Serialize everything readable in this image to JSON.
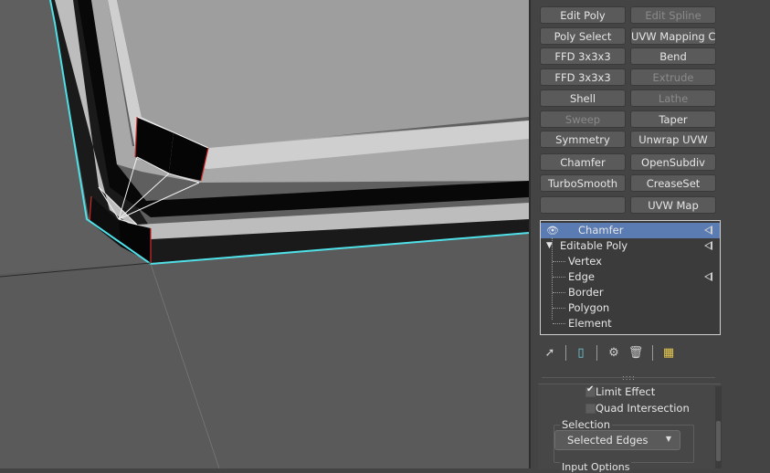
{
  "modifier_buttons": [
    {
      "label": "Edit Poly",
      "enabled": true
    },
    {
      "label": "Edit Spline",
      "enabled": false
    },
    {
      "label": "Poly Select",
      "enabled": true
    },
    {
      "label": "UVW Mapping Clear",
      "enabled": true
    },
    {
      "label": "FFD 3x3x3",
      "enabled": true
    },
    {
      "label": "Bend",
      "enabled": true
    },
    {
      "label": "FFD 3x3x3",
      "enabled": true
    },
    {
      "label": "Extrude",
      "enabled": false
    },
    {
      "label": "Shell",
      "enabled": true
    },
    {
      "label": "Lathe",
      "enabled": false
    },
    {
      "label": "Sweep",
      "enabled": false
    },
    {
      "label": "Taper",
      "enabled": true
    },
    {
      "label": "Symmetry",
      "enabled": true
    },
    {
      "label": "Unwrap UVW",
      "enabled": true
    },
    {
      "label": "Chamfer",
      "enabled": true
    },
    {
      "label": "OpenSubdiv",
      "enabled": true
    },
    {
      "label": "TurboSmooth",
      "enabled": true
    },
    {
      "label": "CreaseSet",
      "enabled": true
    },
    {
      "label": "",
      "enabled": true
    },
    {
      "label": "UVW Map",
      "enabled": true
    }
  ],
  "modifier_stack": {
    "chamfer": "Chamfer",
    "editable_poly": "Editable Poly",
    "vertex": "Vertex",
    "edge": "Edge",
    "border": "Border",
    "polygon": "Polygon",
    "element": "Element"
  },
  "toolbar_icons": [
    "pin-stack-icon",
    "show-end-result-icon",
    "make-unique-icon",
    "remove-modifier-icon",
    "configure-modifier-sets-icon"
  ],
  "parameters": {
    "limit_effect": "Limit Effect",
    "limit_effect_checked": true,
    "quad_intersection": "Quad Intersection",
    "quad_intersection_checked": false,
    "selection_group": "Selection",
    "selection_value": "Selected Edges",
    "input_options": "Input Options"
  },
  "colors": {
    "viewport_bg": "#5f5f5f",
    "selection_highlight": "#5b7cb3",
    "selected_edge": "#4fe0e8"
  }
}
